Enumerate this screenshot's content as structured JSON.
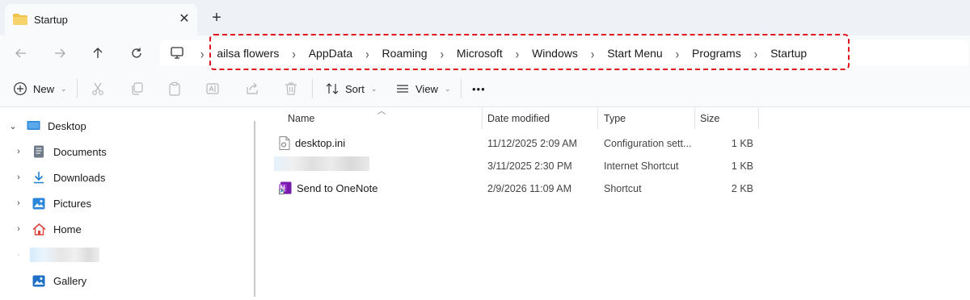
{
  "tab": {
    "title": "Startup",
    "close_glyph": "✕",
    "new_tab_glyph": "+"
  },
  "address": {
    "segments": [
      "ailsa flowers",
      "AppData",
      "Roaming",
      "Microsoft",
      "Windows",
      "Start Menu",
      "Programs",
      "Startup"
    ],
    "separator": "›"
  },
  "toolbar": {
    "new_label": "New",
    "sort_label": "Sort",
    "view_label": "View",
    "more_label": "•••",
    "caret": "⌄"
  },
  "sidebar": {
    "items": [
      {
        "label": "Desktop",
        "icon": "desktop-icon",
        "expanded": true
      },
      {
        "label": "Documents",
        "icon": "documents-icon"
      },
      {
        "label": "Downloads",
        "icon": "downloads-icon"
      },
      {
        "label": "Pictures",
        "icon": "pictures-icon"
      },
      {
        "label": "Home",
        "icon": "home-icon"
      },
      {
        "label": "",
        "icon": "redacted"
      },
      {
        "label": "Gallery",
        "icon": "gallery-icon"
      }
    ]
  },
  "columns": {
    "name": "Name",
    "date": "Date modified",
    "type": "Type",
    "size": "Size"
  },
  "files": [
    {
      "name": "desktop.ini",
      "icon": "ini-file-icon",
      "date": "11/12/2025 2:09 AM",
      "type": "Configuration sett...",
      "size": "1 KB"
    },
    {
      "name": "",
      "icon": "redacted",
      "date": "3/11/2025 2:30 PM",
      "type": "Internet Shortcut",
      "size": "1 KB"
    },
    {
      "name": "Send to OneNote",
      "icon": "onenote-shortcut-icon",
      "date": "2/9/2026 11:09 AM",
      "type": "Shortcut",
      "size": "2 KB"
    }
  ],
  "colors": {
    "highlight": "#e0101e",
    "folder": "#f2c14b",
    "accent": "#0067c0"
  }
}
